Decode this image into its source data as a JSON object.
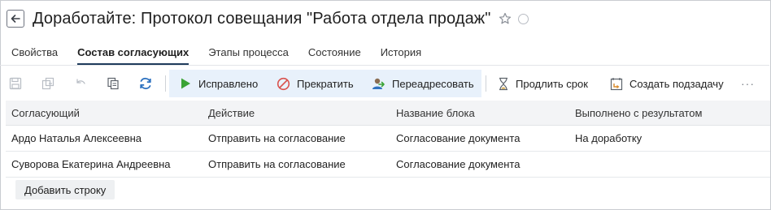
{
  "header": {
    "title": "Доработайте: Протокол совещания \"Работа отдела продаж\""
  },
  "tabs": [
    {
      "label": "Свойства",
      "active": false
    },
    {
      "label": "Состав согласующих",
      "active": true
    },
    {
      "label": "Этапы процесса",
      "active": false
    },
    {
      "label": "Состояние",
      "active": false
    },
    {
      "label": "История",
      "active": false
    }
  ],
  "toolbar": {
    "fixed_label": "Исправлено",
    "stop_label": "Прекратить",
    "redirect_label": "Переадресовать",
    "extend_label": "Продлить срок",
    "subtask_label": "Создать подзадачу",
    "more_label": "···",
    "icons": [
      "save-icon",
      "save-copy-icon",
      "undo-icon",
      "copy-icon",
      "refresh-icon",
      "play-icon",
      "forbidden-icon",
      "user-redirect-icon",
      "hourglass-icon",
      "subtask-icon",
      "more-icon"
    ],
    "colors": {
      "play": "#3aa335",
      "forbidden": "#d9534f",
      "refresh": "#2f73c0",
      "highlight": "#e8f1fb"
    }
  },
  "table": {
    "columns": [
      "Согласующий",
      "Действие",
      "Название блока",
      "Выполнено с результатом"
    ],
    "rows": [
      [
        "Ардо Наталья Алексеевна",
        "Отправить на согласование",
        "Согласование документа",
        "На доработку"
      ],
      [
        "Суворова Екатерина Андреевна",
        "Отправить на согласование",
        "Согласование документа",
        ""
      ]
    ]
  },
  "add_row_label": "Добавить строку"
}
